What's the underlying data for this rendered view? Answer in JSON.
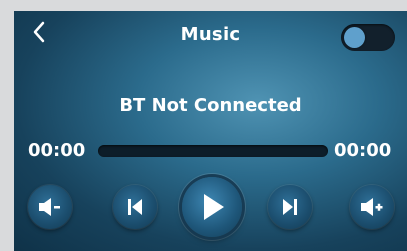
{
  "header": {
    "title": "Music",
    "back_icon": "chevron-left-icon",
    "toggle": {
      "on": false,
      "accent": "#5fa0cc"
    }
  },
  "status": {
    "text": "BT Not Connected"
  },
  "progress": {
    "elapsed": "00:00",
    "total": "00:00",
    "fraction": 0
  },
  "controls": {
    "volume_down_icon": "volume-down-icon",
    "previous_icon": "previous-track-icon",
    "play_icon": "play-icon",
    "next_icon": "next-track-icon",
    "volume_up_icon": "volume-up-icon"
  },
  "colors": {
    "background_dark": "#0f3248",
    "background_light": "#4f93b3",
    "bezel": "#d9dadc"
  }
}
